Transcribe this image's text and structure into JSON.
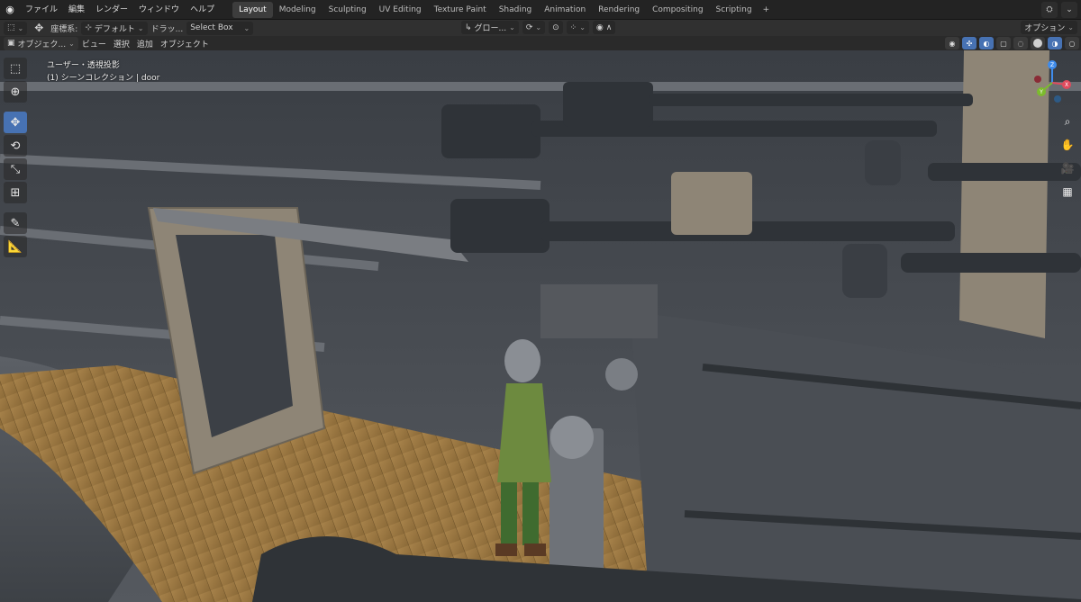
{
  "topbar": {
    "menus": [
      "ファイル",
      "編集",
      "レンダー",
      "ウィンドウ",
      "ヘルプ"
    ],
    "workspaces": [
      "Layout",
      "Modeling",
      "Sculpting",
      "UV Editing",
      "Texture Paint",
      "Shading",
      "Animation",
      "Rendering",
      "Compositing",
      "Scripting"
    ],
    "active_workspace": "Layout",
    "add_tab": "+"
  },
  "toolheader": {
    "orientation_label": "座標系:",
    "orientation_value": "デフォルト",
    "drag_label": "ドラッ...",
    "drag_value": "Select Box",
    "transform_orientation": "グロー...",
    "options": "オプション"
  },
  "viewheader": {
    "mode": "オブジェク...",
    "menus": [
      "ビュー",
      "選択",
      "追加",
      "オブジェクト"
    ]
  },
  "view_info": {
    "line1": "ユーザー・透視投影",
    "line2": "(1) シーンコレクション | door"
  },
  "gizmo": {
    "x": "X",
    "y": "Y",
    "z": "Z"
  },
  "colors": {
    "accent": "#4772b3",
    "axis_x": "#e04a5d",
    "axis_y": "#7cbb2d",
    "axis_z": "#3f8cec"
  }
}
